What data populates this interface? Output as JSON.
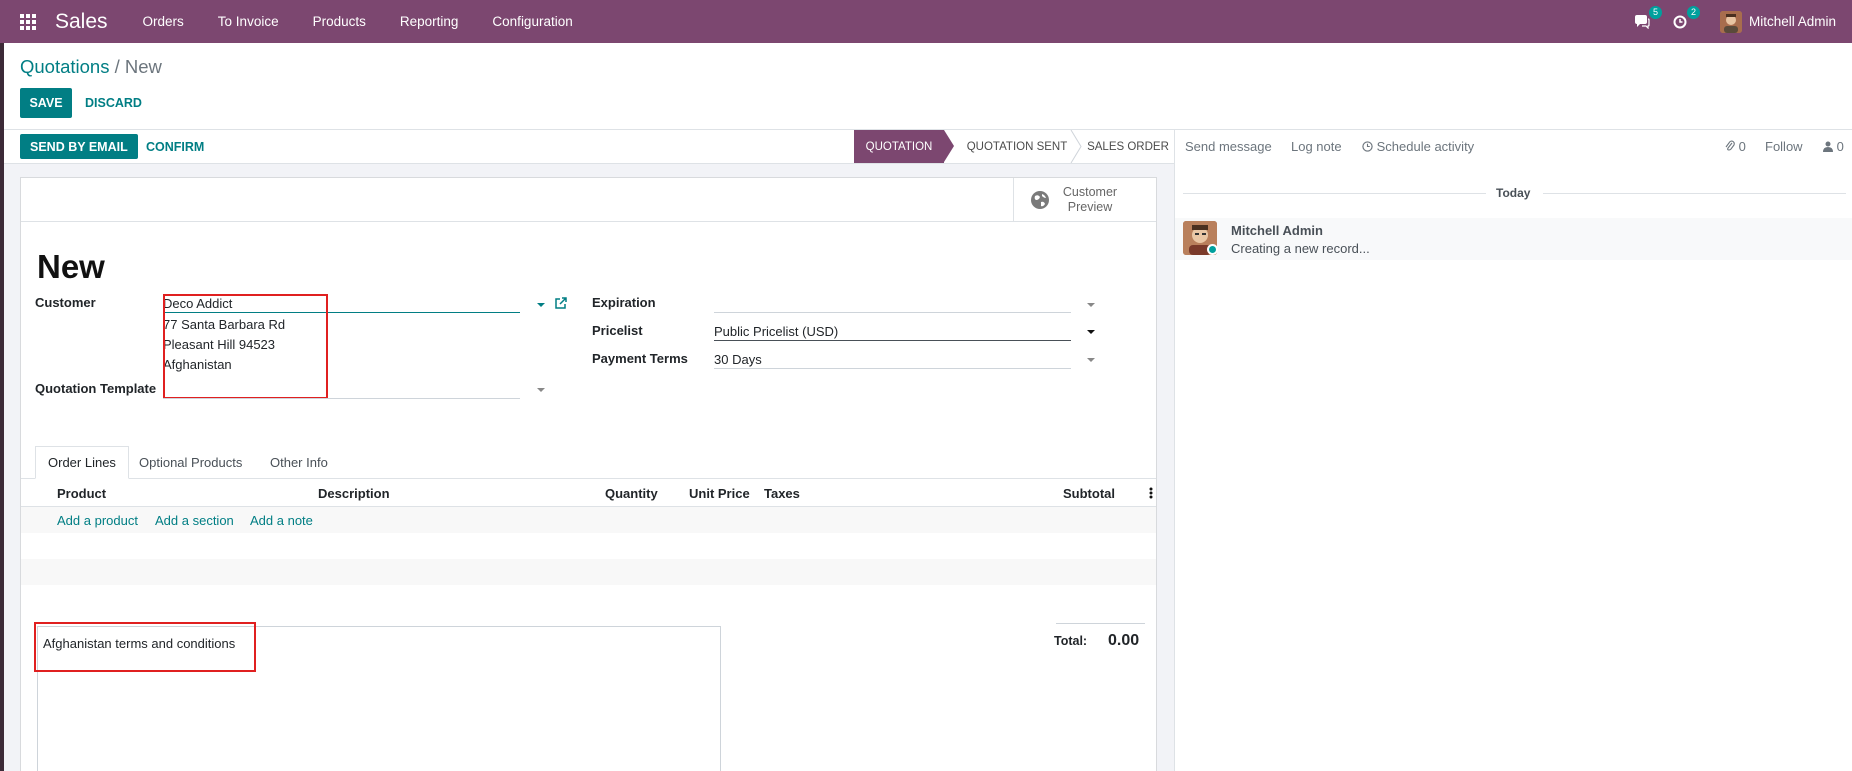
{
  "navbar": {
    "brand": "Sales",
    "menu": [
      "Orders",
      "To Invoice",
      "Products",
      "Reporting",
      "Configuration"
    ],
    "messages_badge": "5",
    "activities_badge": "2",
    "user_name": "Mitchell Admin"
  },
  "control_panel": {
    "breadcrumb_root": "Quotations",
    "breadcrumb_sep": "/",
    "breadcrumb_current": "New",
    "save_label": "SAVE",
    "discard_label": "DISCARD"
  },
  "statusbar": {
    "send_email_label": "SEND BY EMAIL",
    "confirm_label": "CONFIRM",
    "stages": [
      "QUOTATION",
      "QUOTATION SENT",
      "SALES ORDER"
    ],
    "active_stage": "QUOTATION"
  },
  "form": {
    "preview_label_1": "Customer",
    "preview_label_2": "Preview",
    "title": "New",
    "customer_label": "Customer",
    "customer_value": "Deco Addict",
    "address_line1": "77 Santa Barbara Rd",
    "address_line2": "Pleasant Hill 94523",
    "address_line3": "Afghanistan",
    "template_label": "Quotation Template",
    "template_value": "",
    "expiration_label": "Expiration",
    "expiration_value": "",
    "pricelist_label": "Pricelist",
    "pricelist_value": "Public Pricelist (USD)",
    "payment_terms_label": "Payment Terms",
    "payment_terms_value": "30 Days"
  },
  "tabs": [
    "Order Lines",
    "Optional Products",
    "Other Info"
  ],
  "order_lines": {
    "columns": [
      "Product",
      "Description",
      "Quantity",
      "Unit Price",
      "Taxes",
      "Subtotal"
    ],
    "add_product": "Add a product",
    "add_section": "Add a section",
    "add_note": "Add a note"
  },
  "footer": {
    "terms": "Afghanistan terms and conditions",
    "total_label": "Total:",
    "total_value": "0.00"
  },
  "chatter": {
    "send_message": "Send message",
    "log_note": "Log note",
    "schedule_activity": "Schedule activity",
    "attachments_count": "0",
    "follow_label": "Follow",
    "followers_count": "0",
    "date_separator": "Today",
    "message_author": "Mitchell Admin",
    "message_body": "Creating a new record..."
  },
  "colors": {
    "brand": "#7c4770",
    "primary": "#017e84",
    "highlight_box": "#e02020"
  }
}
